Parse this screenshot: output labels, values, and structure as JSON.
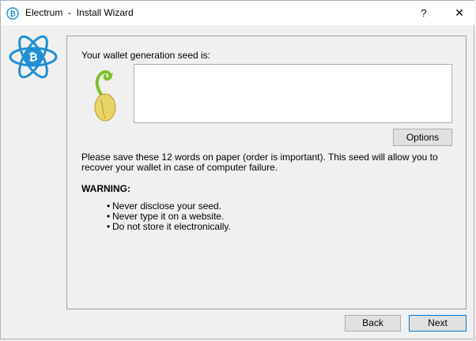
{
  "window": {
    "title": "Electrum  -  Install Wizard",
    "help_label": "?",
    "close_label": "✕"
  },
  "seed_section": {
    "label": "Your wallet generation seed is:",
    "seed_value": "",
    "options_label": "Options"
  },
  "info": {
    "text": "Please save these 12 words on paper (order is important). This seed will allow you to recover your wallet in case of computer failure.",
    "warning_title": "WARNING:",
    "bullet_symbol": "•",
    "bullets": [
      "Never disclose your seed.",
      "Never type it on a website.",
      "Do not store it electronically."
    ]
  },
  "footer": {
    "back_label": "Back",
    "next_label": "Next"
  },
  "colors": {
    "electrum_blue": "#1e8fd6",
    "seed_green": "#7fbf2a",
    "seed_yellow": "#e9d46a"
  }
}
